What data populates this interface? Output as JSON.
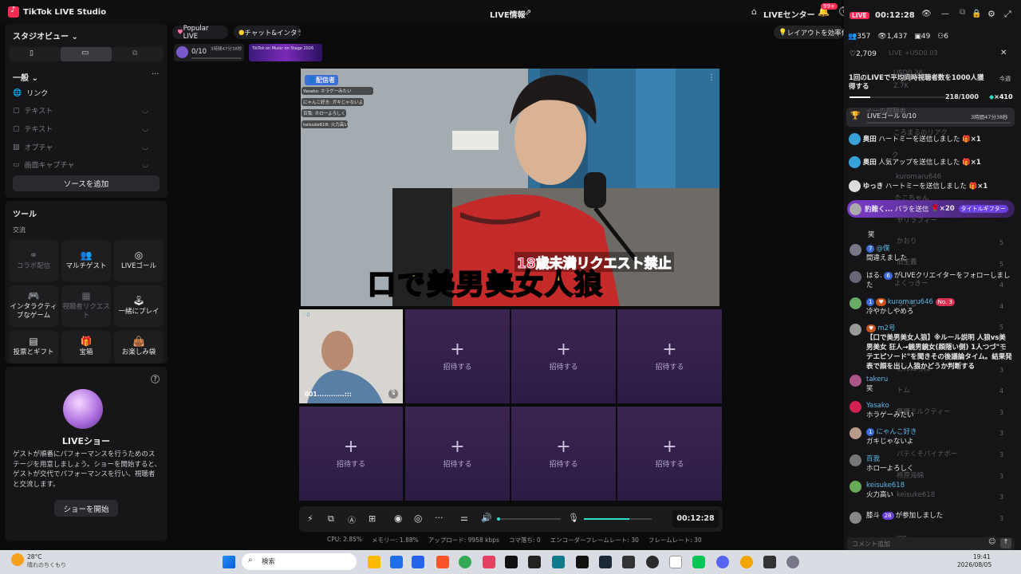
{
  "app": {
    "title": "TikTok LIVE Studio",
    "center_title": "LIVE情報",
    "live_center": "LIVEセンター",
    "notif_count": "99+"
  },
  "left": {
    "studio_view": "スタジオビュー",
    "general": "一般",
    "sources": [
      {
        "label": "リンク",
        "active": true
      },
      {
        "label": "テキスト",
        "active": false
      },
      {
        "label": "テキスト",
        "active": false
      },
      {
        "label": "オプチャ",
        "active": false
      },
      {
        "label": "画面キャプチャ",
        "active": false
      }
    ],
    "add_source": "ソースを追加",
    "tools_title": "ツール",
    "tools_sub": "交流",
    "tools": [
      "コラボ配信",
      "マルチゲスト",
      "LIVEゴール",
      "インタラクティブなゲーム",
      "視聴者リクエスト",
      "一緒にプレイ",
      "投票とギフト",
      "宝箱",
      "お楽しみ袋"
    ],
    "show_title": "LIVEショー",
    "show_desc": "ゲストが順番にパフォーマンスを行うためのステージを用意しましょう。ショーを開始すると、ゲストが交代でパフォーマンスを行い、視聴者と交流します。",
    "show_button": "ショーを開始"
  },
  "center": {
    "tab_popular": "Popular LIVE",
    "tab_chat": "チャット&インタラクション",
    "layout_hint": "レイアウトを効率化",
    "goal_progress": "0/10",
    "goal_time": "3時間47分38秒",
    "promo": "TikTok on Music on Stage 2026",
    "broadcaster_label": "配信者",
    "overlay_chats": [
      "Yasako: ホラゲーみたい",
      "にゃんこ好き: ガキじゃないよ",
      "百我: ホロ一よろしく",
      "keisuke618: 火力高い"
    ],
    "caption_small": "18歳未満リクエスト禁止",
    "caption_big": "口で美男美女人狼",
    "guest_name": "001............:::",
    "guest_count": "0",
    "invite": "招待する",
    "timer": "00:12:28",
    "stats": [
      "CPU: 2.85%",
      "メモリー: 1.88%",
      "アップロード: 9958 kbps",
      "コマ落ち: 0",
      "エンコーダーフレームレート: 30",
      "フレームレート: 30"
    ]
  },
  "right": {
    "live_badge": "LIVE",
    "timer": "00:12:28",
    "viewers": "357",
    "likes_total": "1,437",
    "stat3": "49",
    "stat4": "6",
    "hearts": "2,709",
    "currency": "LIVE +USD0.03",
    "challenge": "1回のLIVEで平均同時視聴者数を1000人獲得する",
    "challenge_tag": "今週",
    "challenge_progress": "218/1000",
    "challenge_reward": "×410",
    "goal_label": "LIVEゴール 0/10",
    "goal_time": "3時間47分38秒",
    "gifts": [
      {
        "user": "奥田",
        "text": "ハートミーを送信しました",
        "count": "×1"
      },
      {
        "user": "奥田",
        "text": "人気アップを送信しました",
        "count": "×1"
      },
      {
        "user": "ゆっき",
        "text": "ハートミーを送信しました",
        "count": "×1"
      }
    ],
    "highlight": {
      "user": "豹難く...",
      "text": "バラを送信",
      "count": "×20",
      "tag": "タイトルギフター"
    },
    "messages": [
      {
        "user": "",
        "text": "笑"
      },
      {
        "user": "@僕",
        "text": "間違えました",
        "lvl": "7"
      },
      {
        "user": "はる.",
        "text": "がLIVEクリエイターをフォローしました",
        "lvl": "6"
      },
      {
        "user": "kuromaru646",
        "text": "冷やかしやめろ",
        "lvl": "1",
        "rank": "No. 3"
      },
      {
        "user": "m2号",
        "text": "【口で美男美女人狼】※ルール説明 人狼vs美男美女 狂人→鏡男鏡女(顔隠い側) 1人つづ\"モテエピソード\"を聞きその後議論タイム。結果発表で顔を出し人狼かどうか判断する"
      },
      {
        "user": "takeru",
        "text": "笑"
      },
      {
        "user": "Yasako",
        "text": "ホラゲーみたい"
      },
      {
        "user": "にゃんこ好き",
        "text": "ガキじゃないよ",
        "lvl": "1"
      },
      {
        "user": "百我",
        "text": "ホロ一よろしく"
      },
      {
        "user": "keisuke618",
        "text": "火力高い"
      },
      {
        "user": "膝斗",
        "text": "が参加しました",
        "lvl": "28"
      }
    ],
    "ghost": [
      "USD0.36",
      "2.7K",
      "イーの視聴者",
      "ク",
      "ころまるのリアク",
      "kuromaru646",
      "たこちゃん",
      "ヤリラフィー",
      "かおり",
      "旧主義",
      "よくっきー",
      "つくる",
      "こんにちは",
      "トム",
      "無糖ミルクティー",
      "パテくそパイナポー",
      "柊原海綿",
      "keisuke618",
      "ion"
    ],
    "comment_placeholder": "コメント追加"
  },
  "taskbar": {
    "temp": "28°C",
    "weather": "晴れのちくもり",
    "search": "検索",
    "time": "19:41",
    "date": "2026/08/05"
  },
  "colors": {
    "accent": "#fe2c55",
    "purple": "#7a3cc8",
    "teal": "#2ee0c8"
  }
}
